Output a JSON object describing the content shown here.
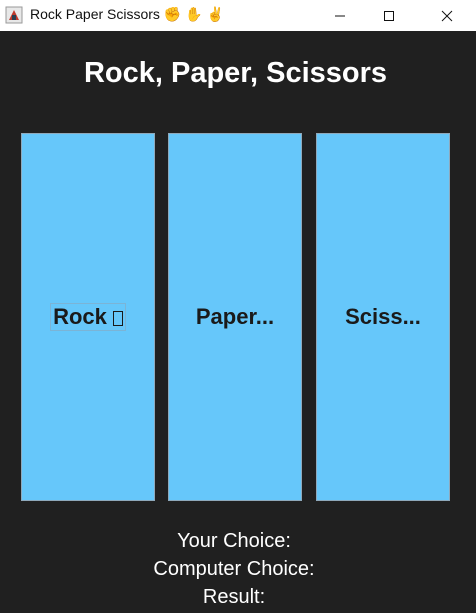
{
  "window": {
    "title": "Rock Paper Scissors",
    "title_emoji": "✊ ✋ ✌"
  },
  "heading": "Rock, Paper, Scissors",
  "buttons": {
    "rock": "Rock",
    "paper": "Paper...",
    "scissors": "Sciss..."
  },
  "info": {
    "your_choice_label": "Your Choice:",
    "your_choice_value": "",
    "computer_choice_label": "Computer Choice:",
    "computer_choice_value": "",
    "result_label": "Result:",
    "result_value": ""
  },
  "colors": {
    "background": "#202020",
    "button": "#66c7fa",
    "text": "#ffffff"
  }
}
